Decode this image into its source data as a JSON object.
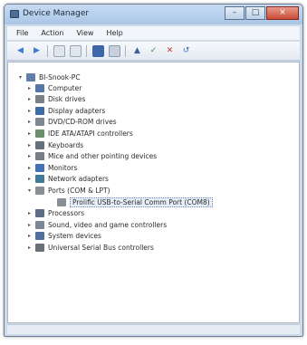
{
  "window": {
    "title": "Device Manager"
  },
  "menu": [
    "File",
    "Action",
    "View",
    "Help"
  ],
  "toolbar": {
    "buttons": [
      "back-icon",
      "forward-icon",
      "properties-icon",
      "help-icon",
      "scan-icon",
      "update-driver-icon",
      "disable-icon",
      "uninstall-icon"
    ]
  },
  "tree": {
    "root": "BI-Snook-PC",
    "items": [
      {
        "label": "Computer",
        "expander": "▸",
        "color": "#5577a8"
      },
      {
        "label": "Disk drives",
        "expander": "▸",
        "color": "#7a7f88"
      },
      {
        "label": "Display adapters",
        "expander": "▸",
        "color": "#3f6aa8"
      },
      {
        "label": "DVD/CD-ROM drives",
        "expander": "▸",
        "color": "#7d8893"
      },
      {
        "label": "IDE ATA/ATAPI controllers",
        "expander": "▸",
        "color": "#6b8f6a"
      },
      {
        "label": "Keyboards",
        "expander": "▸",
        "color": "#666f7c"
      },
      {
        "label": "Mice and other pointing devices",
        "expander": "▸",
        "color": "#777d85"
      },
      {
        "label": "Monitors",
        "expander": "▸",
        "color": "#4472b8"
      },
      {
        "label": "Network adapters",
        "expander": "▸",
        "color": "#3f7a9a"
      },
      {
        "label": "Ports (COM & LPT)",
        "expander": "▾",
        "color": "#8a8f96"
      },
      {
        "label": "Prolific USB-to-Serial Comm Port (COM8)",
        "expander": "",
        "color": "#8a8f96",
        "child": true,
        "selected": true
      },
      {
        "label": "Processors",
        "expander": "▸",
        "color": "#5c6e86"
      },
      {
        "label": "Sound, video and game controllers",
        "expander": "▸",
        "color": "#7b8796"
      },
      {
        "label": "System devices",
        "expander": "▸",
        "color": "#4f6f9c"
      },
      {
        "label": "Universal Serial Bus controllers",
        "expander": "▸",
        "color": "#6a6f78"
      }
    ]
  }
}
